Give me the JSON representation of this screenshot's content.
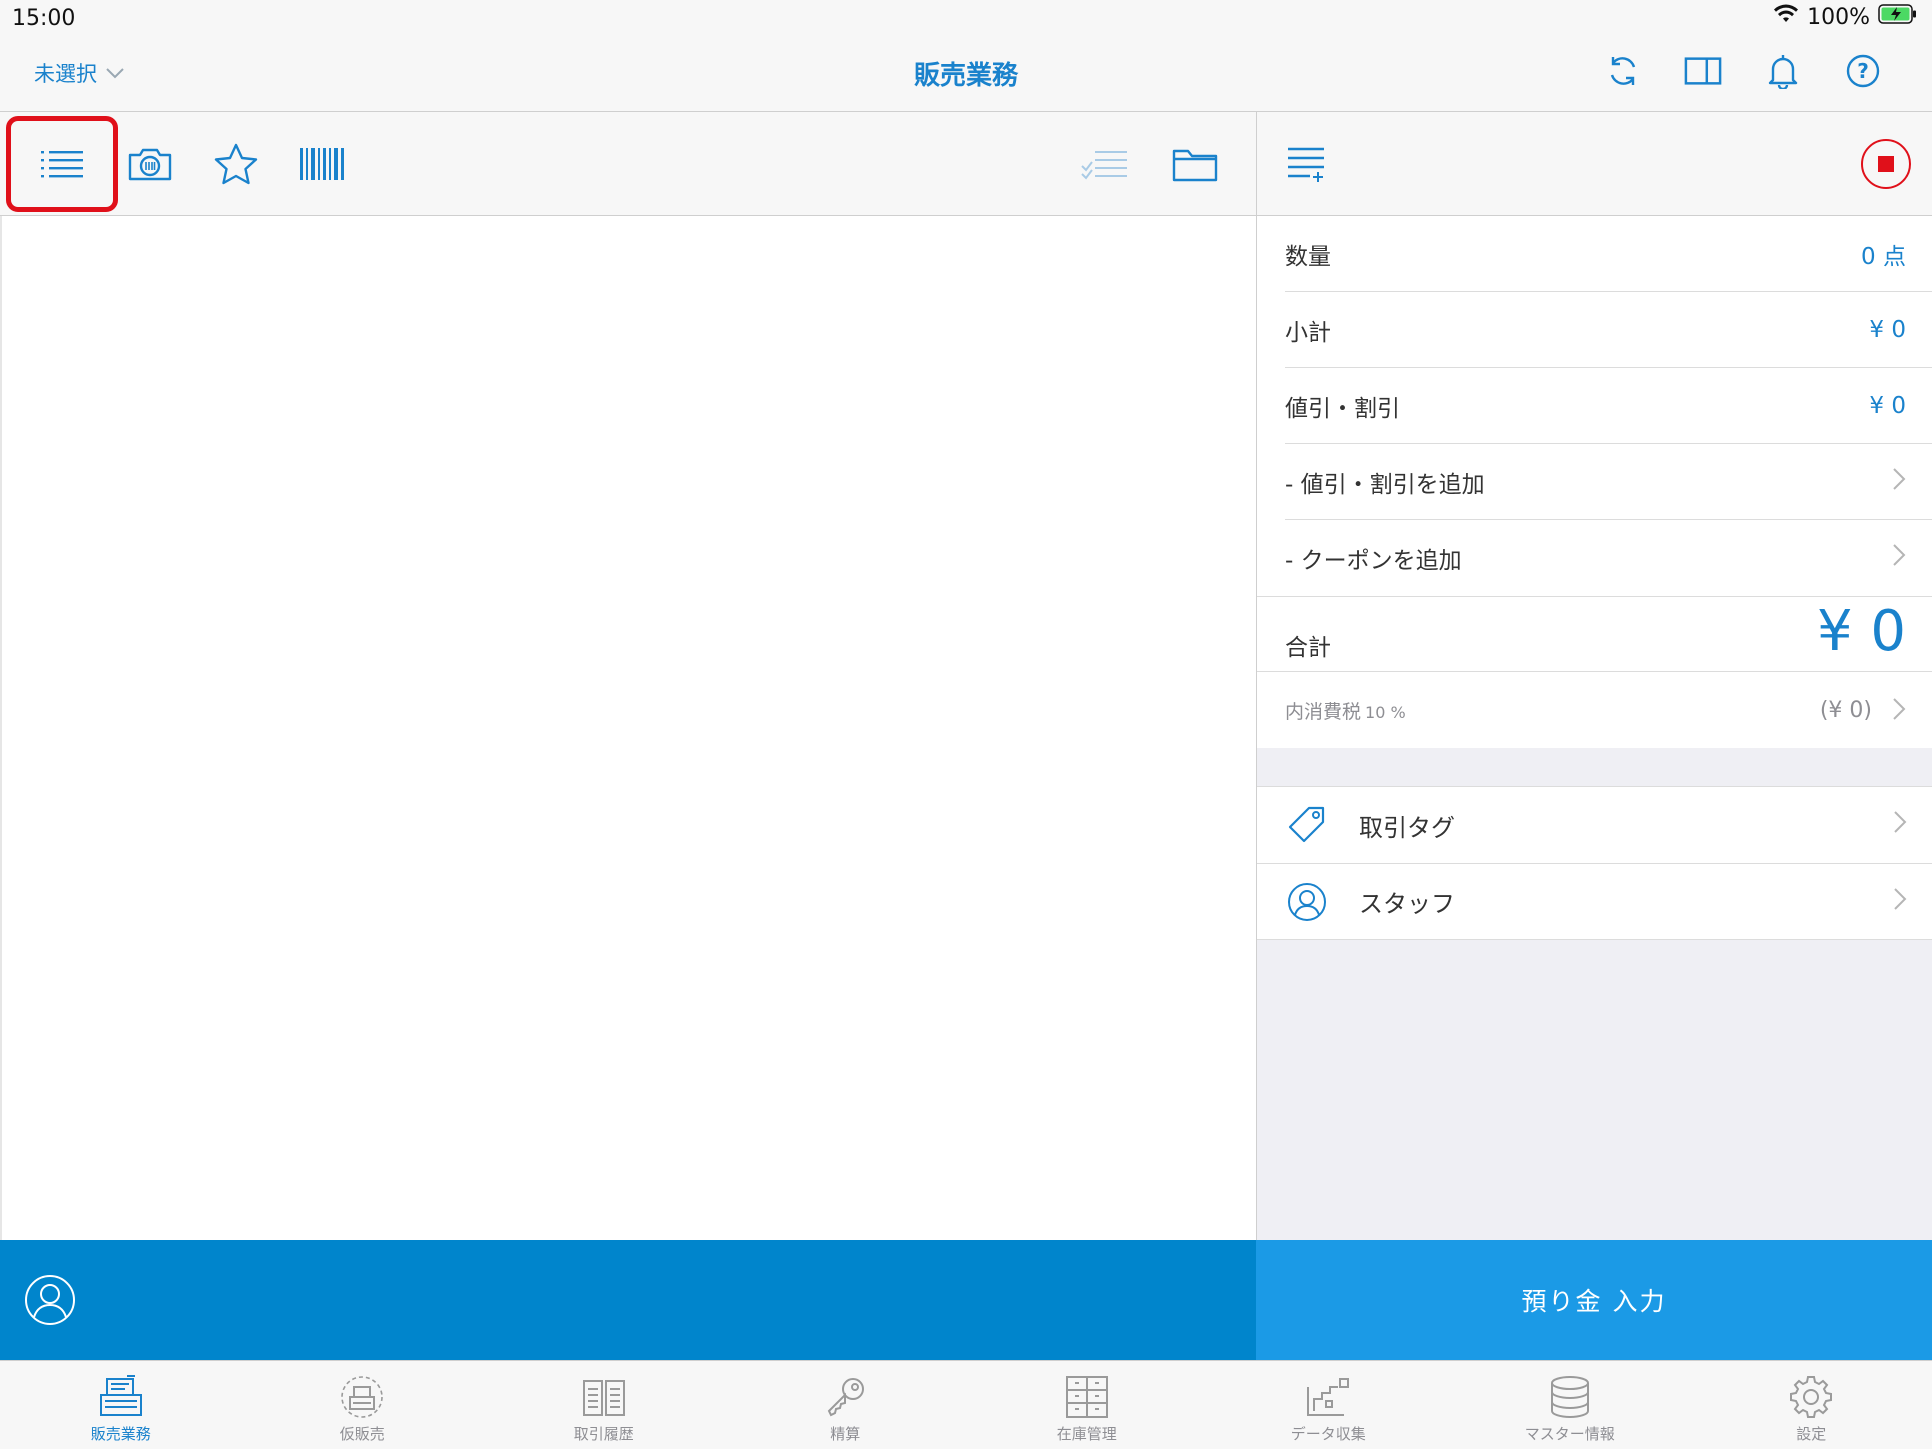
{
  "status_bar": {
    "time": "15:00",
    "battery": "100%"
  },
  "nav": {
    "selector_label": "未選択",
    "title": "販売業務"
  },
  "summary": {
    "quantity_label": "数量",
    "quantity_value": "0 点",
    "subtotal_label": "小計",
    "subtotal_value": "¥ 0",
    "discount_label": "値引・割引",
    "discount_value": "¥ 0",
    "add_discount_label": "- 値引・割引を追加",
    "add_coupon_label": "- クーポンを追加",
    "total_label": "合計",
    "total_value": "¥ 0",
    "tax_label": "内消費税",
    "tax_rate": "10 %",
    "tax_value": "(¥ 0)"
  },
  "extras": {
    "tag_label": "取引タグ",
    "staff_label": "スタッフ"
  },
  "action": {
    "deposit_label": "預り金 入力"
  },
  "tabs": [
    {
      "label": "販売業務",
      "icon": "register-icon",
      "active": true
    },
    {
      "label": "仮販売",
      "icon": "temp-sale-icon",
      "active": false
    },
    {
      "label": "取引履歴",
      "icon": "history-book-icon",
      "active": false
    },
    {
      "label": "精算",
      "icon": "key-icon",
      "active": false
    },
    {
      "label": "在庫管理",
      "icon": "inventory-icon",
      "active": false
    },
    {
      "label": "データ収集",
      "icon": "data-collection-icon",
      "active": false
    },
    {
      "label": "マスター情報",
      "icon": "database-icon",
      "active": false
    },
    {
      "label": "設定",
      "icon": "gear-icon",
      "active": false
    }
  ],
  "colors": {
    "accent": "#1a82cc",
    "action_dark": "#0085cc",
    "action_light": "#1b9ae6",
    "stop": "#e0101a"
  }
}
